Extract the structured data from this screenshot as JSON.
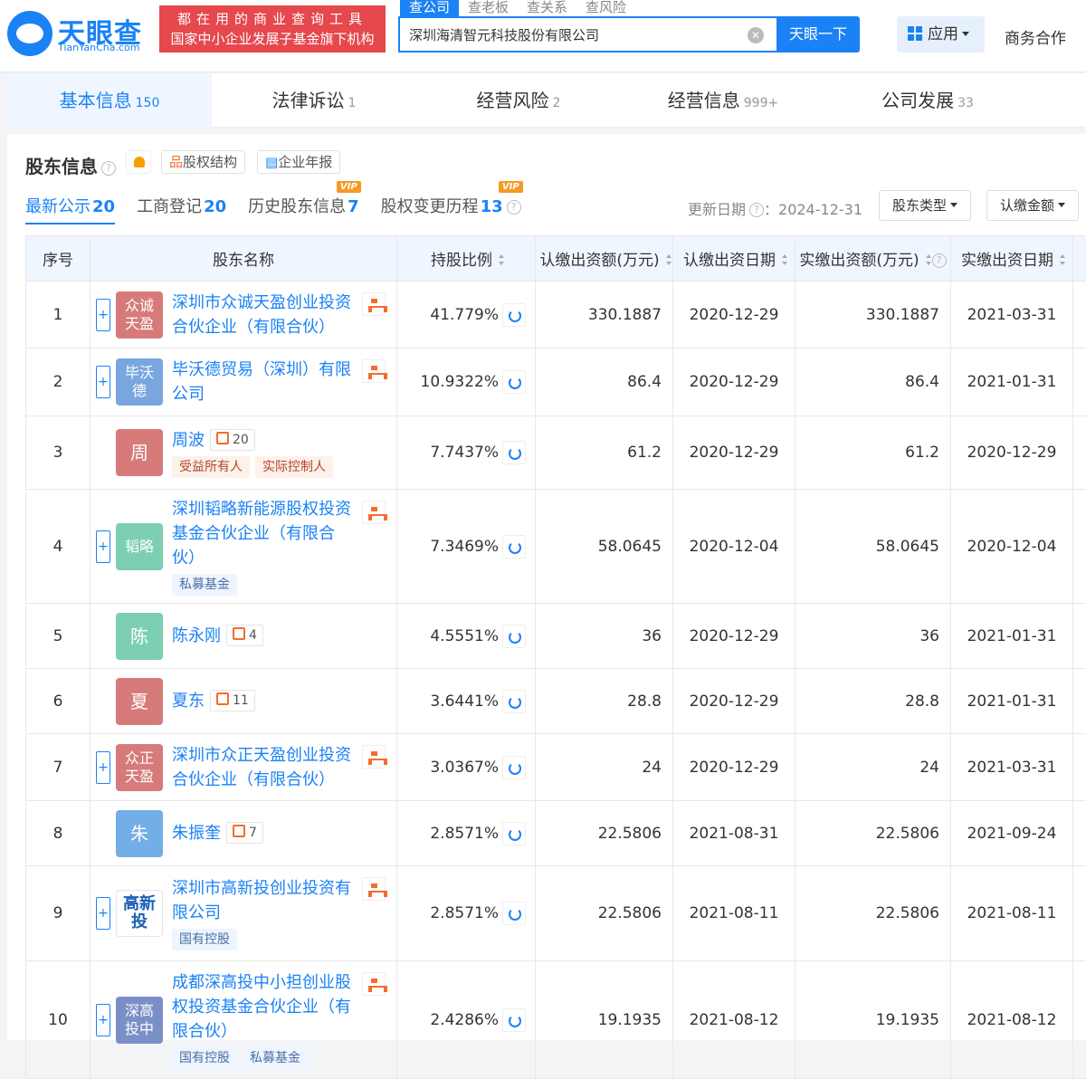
{
  "header": {
    "logo_text": "天眼查",
    "logo_sub": "TianYanCha.com",
    "promo_line1": "都在用的商业查询工具",
    "promo_line2": "国家中小企业发展子基金旗下机构",
    "search_tabs": [
      "查公司",
      "查老板",
      "查关系",
      "查风险"
    ],
    "search_value": "深圳海清智元科技股份有限公司",
    "search_button": "天眼一下",
    "app_button": "应用",
    "business_link": "商务合作"
  },
  "nav": [
    {
      "label": "基本信息",
      "count": "150"
    },
    {
      "label": "法律诉讼",
      "count": "1"
    },
    {
      "label": "经营风险",
      "count": "2"
    },
    {
      "label": "经营信息",
      "count": "999+"
    },
    {
      "label": "公司发展",
      "count": "33"
    }
  ],
  "section": {
    "title": "股东信息",
    "equity_btn": "股权结构",
    "report_btn": "企业年报",
    "subtabs": [
      {
        "label": "最新公示",
        "count": "20"
      },
      {
        "label": "工商登记",
        "count": "20"
      },
      {
        "label": "历史股东信息",
        "count": "7"
      },
      {
        "label": "股权变更历程",
        "count": "13"
      }
    ],
    "vip": "VIP",
    "update_label": "更新日期",
    "update_date": "：2024-12-31",
    "type_dropdown": "股东类型",
    "amount_dropdown": "认缴金额"
  },
  "table": {
    "headers": [
      "序号",
      "股东名称",
      "持股比例",
      "认缴出资额(万元)",
      "认缴出资日期",
      "实缴出资额(万元)",
      "实缴出资日期"
    ],
    "rows": [
      {
        "idx": "1",
        "avatar": "众诚天盈",
        "name": "深圳市众诚天盈创业投资合伙企业（有限合伙）",
        "pct": "41.779%",
        "sub_amt": "330.1887",
        "sub_date": "2020-12-29",
        "paid_amt": "330.1887",
        "paid_date": "2021-03-31"
      },
      {
        "idx": "2",
        "avatar": "毕沃德",
        "name": "毕沃德贸易（深圳）有限公司",
        "pct": "10.9322%",
        "sub_amt": "86.4",
        "sub_date": "2020-12-29",
        "paid_amt": "86.4",
        "paid_date": "2021-01-31"
      },
      {
        "idx": "3",
        "avatar": "周",
        "name": "周波",
        "rel": "20",
        "tags": [
          "受益所有人",
          "实际控制人"
        ],
        "pct": "7.7437%",
        "sub_amt": "61.2",
        "sub_date": "2020-12-29",
        "paid_amt": "61.2",
        "paid_date": "2020-12-29"
      },
      {
        "idx": "4",
        "avatar": "韬略",
        "name": "深圳韬略新能源股权投资基金合伙企业（有限合伙）",
        "tags": [
          "私募基金"
        ],
        "pct": "7.3469%",
        "sub_amt": "58.0645",
        "sub_date": "2020-12-04",
        "paid_amt": "58.0645",
        "paid_date": "2020-12-04"
      },
      {
        "idx": "5",
        "avatar": "陈",
        "name": "陈永刚",
        "rel": "4",
        "pct": "4.5551%",
        "sub_amt": "36",
        "sub_date": "2020-12-29",
        "paid_amt": "36",
        "paid_date": "2021-01-31"
      },
      {
        "idx": "6",
        "avatar": "夏",
        "name": "夏东",
        "rel": "11",
        "pct": "3.6441%",
        "sub_amt": "28.8",
        "sub_date": "2020-12-29",
        "paid_amt": "28.8",
        "paid_date": "2021-01-31"
      },
      {
        "idx": "7",
        "avatar": "众正天盈",
        "name": "深圳市众正天盈创业投资合伙企业（有限合伙）",
        "pct": "3.0367%",
        "sub_amt": "24",
        "sub_date": "2020-12-29",
        "paid_amt": "24",
        "paid_date": "2021-03-31"
      },
      {
        "idx": "8",
        "avatar": "朱",
        "name": "朱振奎",
        "rel": "7",
        "pct": "2.8571%",
        "sub_amt": "22.5806",
        "sub_date": "2021-08-31",
        "paid_amt": "22.5806",
        "paid_date": "2021-09-24"
      },
      {
        "idx": "9",
        "avatar": "高新投",
        "name": "深圳市高新投创业投资有限公司",
        "tags": [
          "国有控股"
        ],
        "pct": "2.8571%",
        "sub_amt": "22.5806",
        "sub_date": "2021-08-11",
        "paid_amt": "22.5806",
        "paid_date": "2021-08-11"
      },
      {
        "idx": "10",
        "avatar": "深高投中",
        "name": "成都深高投中小担创业股权投资基金合伙企业（有限合伙）",
        "tags": [
          "国有控股",
          "私募基金"
        ],
        "pct": "2.4286%",
        "sub_amt": "19.1935",
        "sub_date": "2021-08-12",
        "paid_amt": "19.1935",
        "paid_date": "2021-08-12"
      }
    ]
  },
  "colors": {
    "accent": "#1a82f5",
    "promo": "#e5484d"
  }
}
